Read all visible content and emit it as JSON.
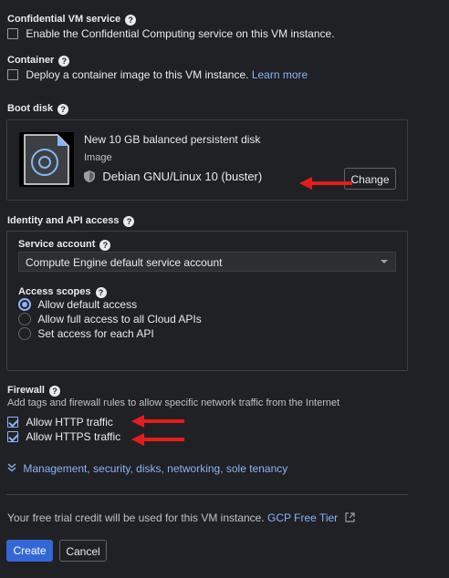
{
  "confidential": {
    "title": "Confidential VM service",
    "checkbox_label": "Enable the Confidential Computing service on this VM instance."
  },
  "container": {
    "title": "Container",
    "checkbox_label": "Deploy a container image to this VM instance.",
    "learn_more": "Learn more"
  },
  "boot_disk": {
    "title": "Boot disk",
    "disk_name": "New 10 GB balanced persistent disk",
    "image_label": "Image",
    "image_value": "Debian GNU/Linux 10 (buster)",
    "change_button": "Change"
  },
  "identity": {
    "title": "Identity and API access",
    "service_account_label": "Service account",
    "service_account_value": "Compute Engine default service account",
    "access_scopes_label": "Access scopes",
    "scopes": [
      {
        "label": "Allow default access",
        "selected": true
      },
      {
        "label": "Allow full access to all Cloud APIs",
        "selected": false
      },
      {
        "label": "Set access for each API",
        "selected": false
      }
    ]
  },
  "firewall": {
    "title": "Firewall",
    "description": "Add tags and firewall rules to allow specific network traffic from the Internet",
    "http_label": "Allow HTTP traffic",
    "https_label": "Allow HTTPS traffic"
  },
  "management_link": "Management, security, disks, networking, sole tenancy",
  "footer": {
    "trial_text": "Your free trial credit will be used for this VM instance.",
    "free_tier_link": "GCP Free Tier"
  },
  "actions": {
    "create": "Create",
    "cancel": "Cancel"
  },
  "colors": {
    "background": "#202124",
    "accent": "#8ab4f8",
    "primary_button": "#3367d6",
    "annotation_arrow": "#e51c1c"
  }
}
